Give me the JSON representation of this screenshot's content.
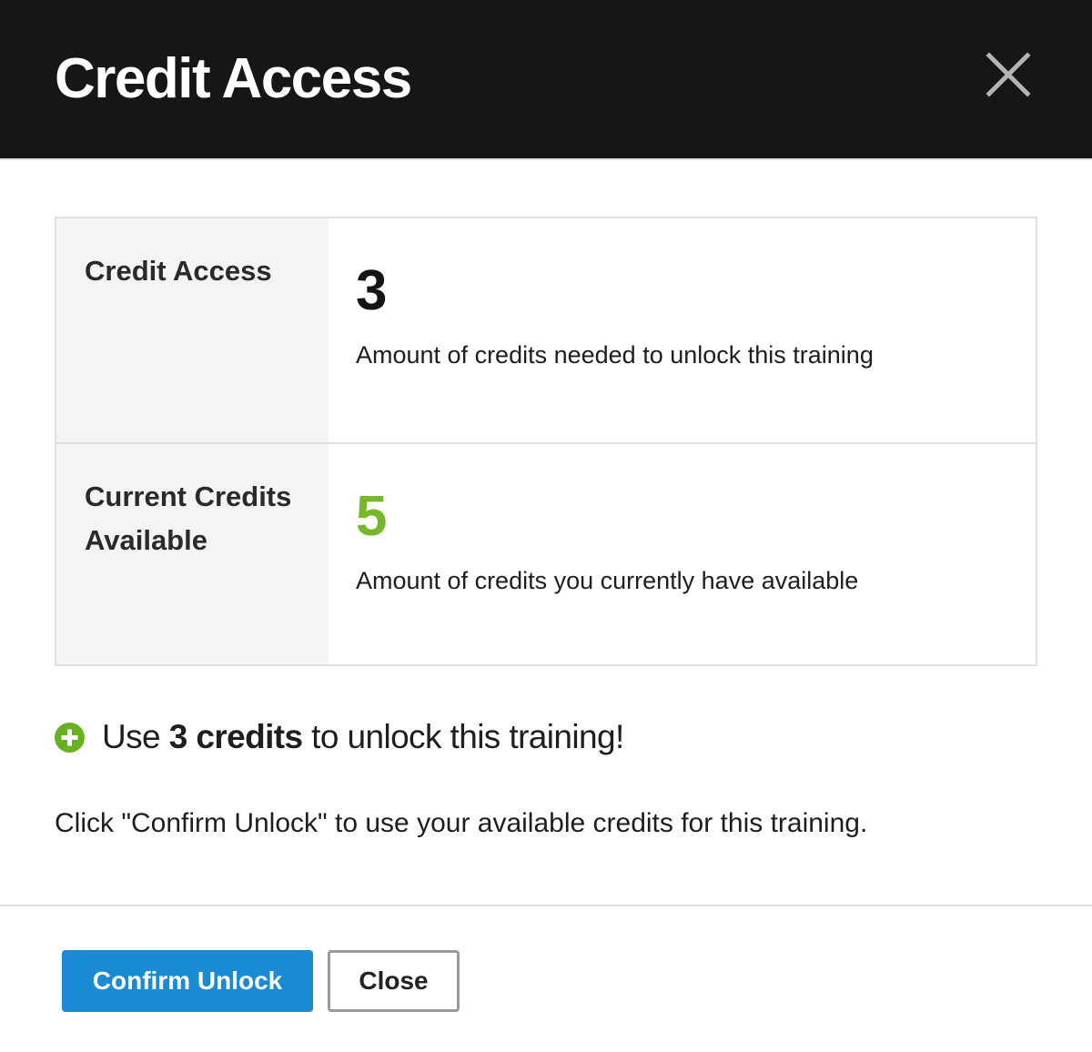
{
  "header": {
    "title": "Credit Access"
  },
  "credits_table": {
    "rows": [
      {
        "label": "Credit Access",
        "value": "3",
        "description": "Amount of credits needed to unlock this training"
      },
      {
        "label": "Current Credits Available",
        "value": "5",
        "description": "Amount of credits you currently have available"
      }
    ]
  },
  "unlock_message": {
    "prefix": "Use ",
    "emphasis": "3 credits",
    "suffix": " to unlock this training!"
  },
  "instruction": "Click \"Confirm Unlock\" to use your available credits for this training.",
  "buttons": {
    "confirm_label": "Confirm Unlock",
    "close_label": "Close"
  },
  "icons": {
    "close": "close-icon",
    "plus": "plus-circle-icon"
  },
  "colors": {
    "header_background": "#161616",
    "available_value": "#76b82a",
    "primary_button": "#1a8ad5",
    "plus_icon": "#6ab023"
  }
}
